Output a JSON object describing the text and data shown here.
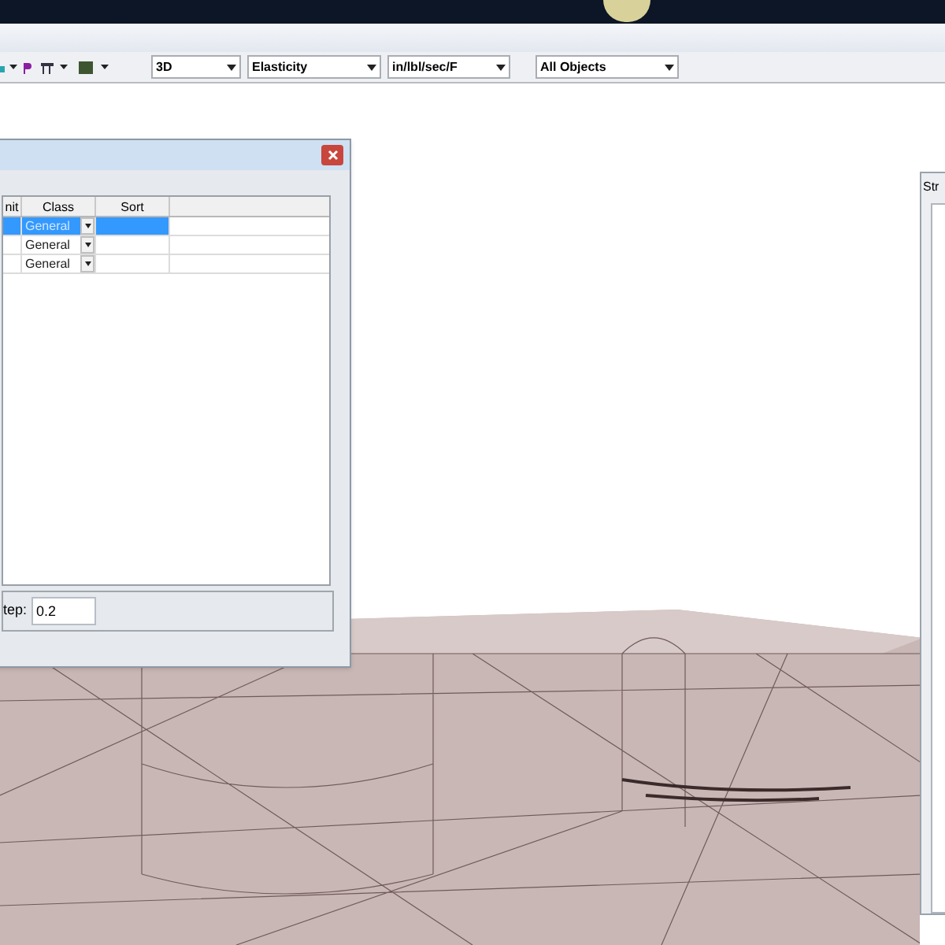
{
  "toolbar": {
    "dropdowns": [
      {
        "value": "3D"
      },
      {
        "value": "Elasticity"
      },
      {
        "value": "in/lbl/sec/F"
      },
      {
        "value": "All Objects"
      }
    ]
  },
  "dialog": {
    "columns": [
      "nit",
      "Class",
      "Sort"
    ],
    "rows": [
      {
        "class": "General",
        "selected": true
      },
      {
        "class": "General",
        "selected": false
      },
      {
        "class": "General",
        "selected": false
      }
    ],
    "step_label": "tep:",
    "step_value": "0.2"
  },
  "side_panel": {
    "title": "Str"
  }
}
